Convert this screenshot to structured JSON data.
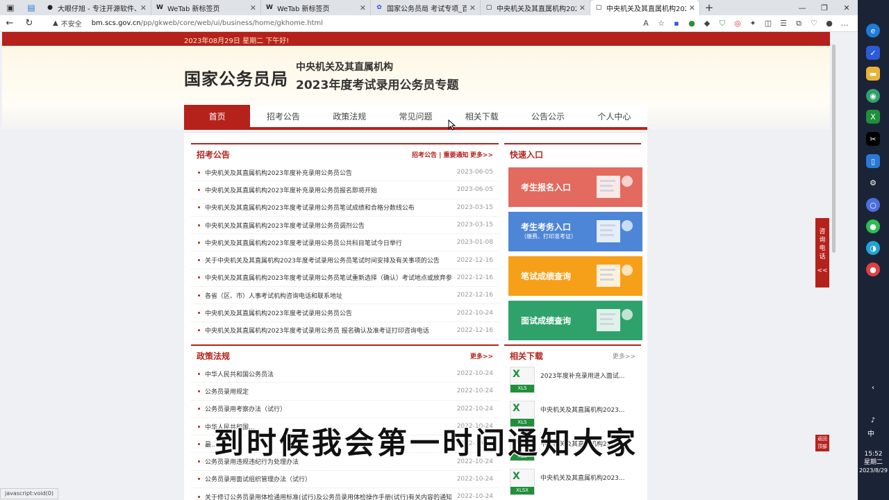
{
  "browser": {
    "tabs": [
      {
        "label": "大眼仔旭 - 专注开源软件、视频教程",
        "icon": "github-icon",
        "active": false
      },
      {
        "label": "WeTab 新标签页",
        "icon": "wetab-icon",
        "active": false
      },
      {
        "label": "WeTab 新标签页",
        "icon": "wetab-icon",
        "active": false
      },
      {
        "label": "国家公务员局 考试专项_百度搜索",
        "icon": "baidu-icon",
        "active": false
      },
      {
        "label": "中央机关及其直属机构2023年度",
        "icon": "page-icon",
        "active": false
      },
      {
        "label": "中央机关及其直属机构2023年度",
        "icon": "page-icon",
        "active": true
      }
    ],
    "security_label": "不安全",
    "url_host": "bm.scs.gov.cn",
    "url_path": "/pp/gkweb/core/web/ui/business/home/gkhome.html",
    "status_text": "javascript:void(0)"
  },
  "site": {
    "date_line": "2023年08月29日  星期二  下午好!",
    "logo_main": "国家公务员局",
    "logo_sub1": "中央机关及其直属机构",
    "logo_sub2": "2023年度考试录用公务员专题",
    "nav": [
      "首页",
      "招考公告",
      "政策法规",
      "常见问题",
      "相关下载",
      "公告公示",
      "个人中心"
    ],
    "announcements": {
      "title": "招考公告",
      "extra": "招考公告 | 重要通知",
      "more": "更多>>",
      "items": [
        {
          "title": "中央机关及其直属机构2023年度补充录用公务员公告",
          "date": "2023-06-05"
        },
        {
          "title": "中央机关及其直属机构2023年度补充录用公务员报名即将开始",
          "date": "2023-06-05"
        },
        {
          "title": "中央机关及其直属机构2023年度考试录用公务员笔试成绩和合格分数线公布",
          "date": "2023-03-15"
        },
        {
          "title": "中央机关及其直属机构2023年度考试录用公务员调剂公告",
          "date": "2023-03-15"
        },
        {
          "title": "中央机关及其直属机构2023年度考试录用公务员公共科目笔试今日举行",
          "date": "2023-01-08"
        },
        {
          "title": "关于中央机关及其直属机构2023年度考试录用公务员笔试时间安排及有关事项的公告",
          "date": "2022-12-16"
        },
        {
          "title": "中央机关及其直属机构2023年度考试录用公务员笔试重新选择（确认）考试地点或放弃参...",
          "date": "2022-12-16"
        },
        {
          "title": "各省（区、市）人事考试机构咨询电话和联系地址",
          "date": "2022-12-16"
        },
        {
          "title": "中央机关及其直属机构2023年度考试录用公务员公告",
          "date": "2022-10-24"
        },
        {
          "title": "中央机关及其直属机构2023年度考试录用公务员 报名确认及准考证打印咨询电话",
          "date": "2022-12-16"
        }
      ]
    },
    "policies": {
      "title": "政策法规",
      "more": "更多>>",
      "items": [
        {
          "title": "中华人民共和国公务员法",
          "date": "2022-10-24"
        },
        {
          "title": "公务员录用规定",
          "date": "2022-10-24"
        },
        {
          "title": "公务员录用考察办法（试行）",
          "date": "2022-10-24"
        },
        {
          "title": "中华人民共和国...",
          "date": "2022-10-24"
        },
        {
          "title": "最...",
          "date": "2022-10-24"
        },
        {
          "title": "公务员录用违规违纪行为处理办法",
          "date": "2022-10-24"
        },
        {
          "title": "公务员录用面试组织管理办法（试行）",
          "date": "2022-10-24"
        },
        {
          "title": "关于修订公务员录用体检通用标准(试行)及公务员录用体检操作手册(试行)有关内容的通知",
          "date": "2022-10-24"
        }
      ]
    },
    "quick": {
      "title": "快速入口",
      "tiles": [
        {
          "label": "考生报名入口",
          "sub": "",
          "color": "#e36a5e"
        },
        {
          "label": "考生考务入口",
          "sub": "（缴费、打印准考证）",
          "color": "#4d86d6"
        },
        {
          "label": "笔试成绩查询",
          "sub": "",
          "color": "#f6a019"
        },
        {
          "label": "面试成绩查询",
          "sub": "",
          "color": "#2fa26c"
        }
      ]
    },
    "downloads": {
      "title": "相关下载",
      "more": "更多>>",
      "items": [
        {
          "title": "2023年度补充录用进入面试...",
          "type": "XLS"
        },
        {
          "title": "中央机关及其直属机构2023...",
          "type": "XLS"
        },
        {
          "title": "中央机关及其直属机构2023...",
          "type": "XLS"
        },
        {
          "title": "中央机关及其直属机构2023...",
          "type": "XLSX"
        }
      ]
    },
    "float_consult": "咨询电话",
    "float_consult_arrow": "<<",
    "float_top": "返回顶部"
  },
  "video_subtitle": "到时候我会第一时间通知大家",
  "system": {
    "ime": "中",
    "time": "15:52",
    "weekday": "星期二",
    "date": "2023/8/29"
  }
}
